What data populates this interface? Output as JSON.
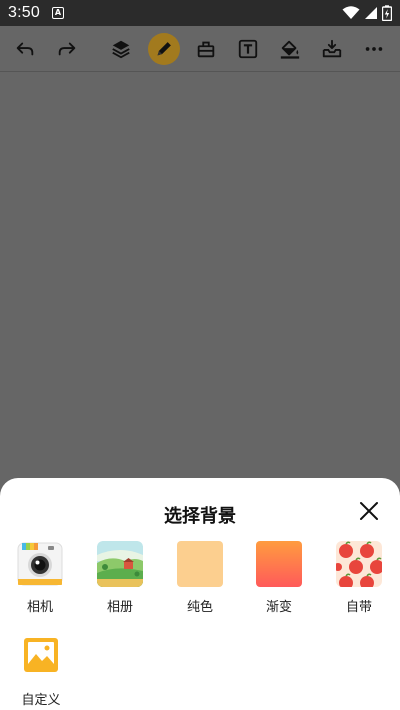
{
  "status_bar": {
    "time": "3:50",
    "notification_icon": "a-letter-icon",
    "wifi_icon": "wifi-icon",
    "signal_icon": "signal-icon",
    "battery_icon": "battery-charging-icon"
  },
  "toolbar": {
    "tools": [
      {
        "name": "undo-icon"
      },
      {
        "name": "redo-icon"
      },
      {
        "name": "layers-icon"
      },
      {
        "name": "pencil-icon",
        "active": true
      },
      {
        "name": "eraser-icon"
      },
      {
        "name": "text-icon"
      },
      {
        "name": "fill-bucket-icon"
      },
      {
        "name": "save-tray-icon"
      },
      {
        "name": "more-icon"
      }
    ],
    "active_color": "#a27a1e"
  },
  "sheet": {
    "title": "选择背景",
    "options": [
      {
        "label": "相机",
        "icon": "camera-icon"
      },
      {
        "label": "相册",
        "icon": "album-landscape-icon"
      },
      {
        "label": "纯色",
        "icon": "solid-color-swatch"
      },
      {
        "label": "渐变",
        "icon": "gradient-swatch"
      },
      {
        "label": "自带",
        "icon": "apple-pattern-icon"
      },
      {
        "label": "自定义",
        "icon": "custom-image-icon"
      }
    ],
    "close_icon": "close-icon"
  },
  "colors": {
    "canvas": "#666666",
    "solid": "#fccf8f",
    "gradient_top": "#ff9c3f",
    "gradient_bottom": "#ff5a5a",
    "custom": "#f8b324"
  }
}
